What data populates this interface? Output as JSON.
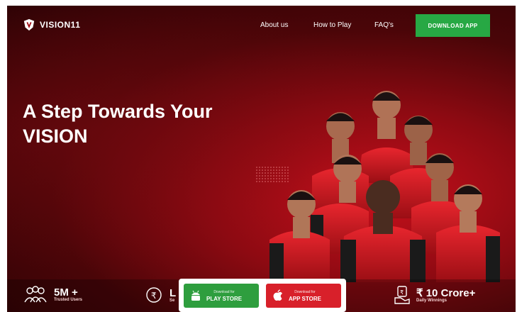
{
  "header": {
    "logo_text": "VISION11",
    "nav": [
      "About us",
      "How to Play",
      "FAQ's"
    ],
    "download_label": "DOWNLOAD APP"
  },
  "hero": {
    "headline_line1": "A Step Towards Your",
    "headline_line2": "VISION"
  },
  "stats": [
    {
      "value": "5M +",
      "label": "Trusted Users",
      "icon": "users-icon"
    },
    {
      "value": "L",
      "label": "Se",
      "icon": "rupee-coin-icon"
    },
    {
      "value": "₹ 10 Crore+",
      "label": "Daily Winnings",
      "icon": "money-hand-icon"
    }
  ],
  "stores": {
    "play": {
      "small": "Download for",
      "big": "PLAY STORE",
      "icon": "android-icon"
    },
    "app": {
      "small": "Download for",
      "big": "APP STORE",
      "icon": "apple-icon"
    }
  },
  "colors": {
    "accent_green": "#27a844",
    "brand_red": "#c8101c",
    "app_store_red": "#d8202a",
    "play_green": "#2e9e3e"
  }
}
